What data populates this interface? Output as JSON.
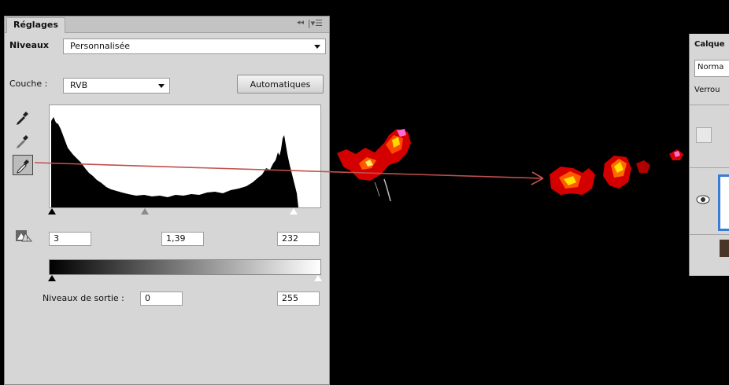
{
  "adjustments_panel": {
    "tab_label": "Réglages",
    "collapse_glyph": "◂◂",
    "menu_glyph": "|▾☰",
    "preset_label": "Niveaux",
    "preset_value": "Personnalisée",
    "channel_label": "Couche :",
    "channel_value": "RVB",
    "auto_button_label": "Automatiques",
    "input_black": "3",
    "input_gamma": "1,39",
    "input_white": "232",
    "output_label": "Niveaux de sortie :",
    "output_black": "0",
    "output_white": "255"
  },
  "histogram_levels": {
    "input_black": 3,
    "input_gamma": 1.39,
    "input_white": 232,
    "output_black": 0,
    "output_white": 255
  },
  "icons": {
    "black_point": "black-point-eyedropper-icon",
    "gray_point": "gray-point-eyedropper-icon",
    "white_point": "white-point-eyedropper-icon",
    "clipping": "clipping-warning-icon",
    "visibility": "eye-icon"
  },
  "layers_panel": {
    "title": "Calque",
    "blend_mode": "Norma",
    "lock_label": "Verrou"
  },
  "colors": {
    "panel_bg": "#d6d6d6",
    "annotation_arrow": "#c0504d",
    "selection_border": "#3a7bd5"
  }
}
